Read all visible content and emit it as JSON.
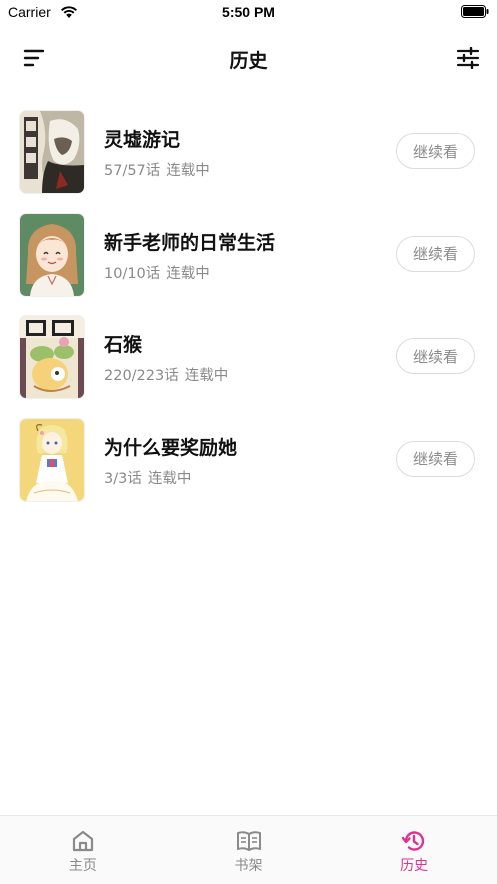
{
  "status_bar": {
    "carrier": "Carrier",
    "time": "5:50 PM",
    "icons": [
      "wifi-icon",
      "battery-icon"
    ]
  },
  "nav": {
    "title": "历史",
    "left_icon": "menu-lines-icon",
    "right_icon": "filter-sliders-icon"
  },
  "history": {
    "items": [
      {
        "title": "灵墟游记",
        "progress": "57/57话",
        "status": "连载中",
        "button": "继续看",
        "cover": "lingxu-cover"
      },
      {
        "title": "新手老师的日常生活",
        "progress": "10/10话",
        "status": "连载中",
        "button": "继续看",
        "cover": "teacher-cover"
      },
      {
        "title": "石猴",
        "progress": "220/223话",
        "status": "连载中",
        "button": "继续看",
        "cover": "shihou-cover"
      },
      {
        "title": "为什么要奖励她",
        "progress": "3/3话",
        "status": "连载中",
        "button": "继续看",
        "cover": "reward-cover"
      }
    ]
  },
  "tabs": [
    {
      "label": "主页",
      "icon": "home-icon",
      "active": false
    },
    {
      "label": "书架",
      "icon": "book-icon",
      "active": false
    },
    {
      "label": "历史",
      "icon": "history-icon",
      "active": true
    }
  ],
  "colors": {
    "accent": "#e0338f",
    "secondary_text": "#8a8a8a",
    "border": "#dcdcdc"
  }
}
